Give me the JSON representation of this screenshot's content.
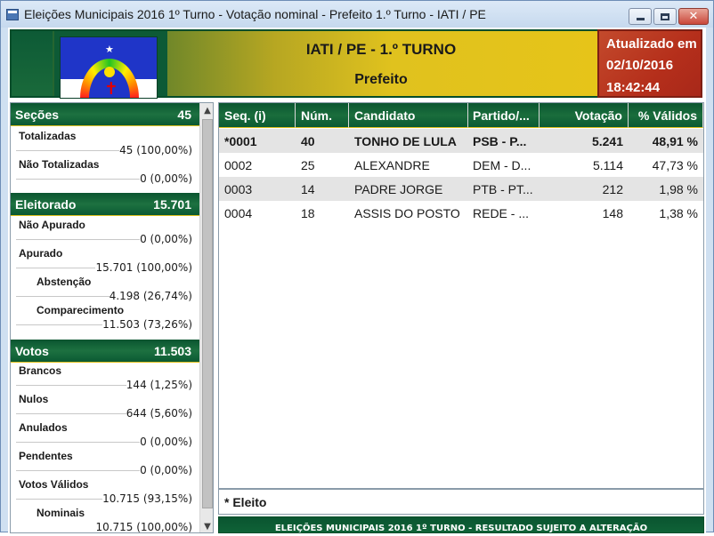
{
  "window": {
    "title": "Eleições Municipais 2016 1º Turno - Votação nominal - Prefeito 1.º Turno - IATI / PE"
  },
  "header": {
    "city_title": "IATI / PE - 1.º TURNO",
    "office_title": "Prefeito",
    "update_label": "Atualizado em",
    "update_date": "02/10/2016",
    "update_time": "18:42:44",
    "flag_icon": "pernambuco-flag"
  },
  "summary": {
    "secoes": {
      "label": "Seções",
      "value": "45",
      "items": [
        {
          "label": "Totalizadas",
          "value": "45 (100,00%)"
        },
        {
          "label": "Não Totalizadas",
          "value": "0 (0,00%)"
        }
      ]
    },
    "eleitorado": {
      "label": "Eleitorado",
      "value": "15.701",
      "items": [
        {
          "label": "Não Apurado",
          "value": "0 (0,00%)"
        },
        {
          "label": "Apurado",
          "value": "15.701 (100,00%)"
        },
        {
          "label": "Abstenção",
          "value": "4.198 (26,74%)"
        },
        {
          "label": "Comparecimento",
          "value": "11.503 (73,26%)"
        }
      ]
    },
    "votos": {
      "label": "Votos",
      "value": "11.503",
      "items": [
        {
          "label": "Brancos",
          "value": "144 (1,25%)"
        },
        {
          "label": "Nulos",
          "value": "644 (5,60%)"
        },
        {
          "label": "Anulados",
          "value": "0 (0,00%)"
        },
        {
          "label": "Pendentes",
          "value": "0 (0,00%)"
        },
        {
          "label": "Votos Válidos",
          "value": "10.715 (93,15%)"
        },
        {
          "label": "Nominais",
          "value": "10.715 (100,00%)"
        }
      ]
    }
  },
  "table": {
    "columns": [
      "Seq.  (i)",
      "Núm.",
      "Candidato",
      "Partido/...",
      "Votação",
      "% Válidos"
    ],
    "rows": [
      {
        "seq": "*0001",
        "num": "40",
        "candidato": "TONHO DE LULA",
        "partido": "PSB - P...",
        "votacao": "5.241",
        "validos": "48,91 %",
        "elected": true
      },
      {
        "seq": "0002",
        "num": "25",
        "candidato": "ALEXANDRE",
        "partido": "DEM - D...",
        "votacao": "5.114",
        "validos": "47,73 %",
        "elected": false
      },
      {
        "seq": "0003",
        "num": "14",
        "candidato": "PADRE JORGE",
        "partido": "PTB - PT...",
        "votacao": "212",
        "validos": "1,98 %",
        "elected": false
      },
      {
        "seq": "0004",
        "num": "18",
        "candidato": "ASSIS DO POSTO",
        "partido": "REDE - ...",
        "votacao": "148",
        "validos": "1,38 %",
        "elected": false
      }
    ]
  },
  "footnote": "* Eleito",
  "status_bar": "ELEIÇÕES MUNICIPAIS 2016 1º TURNO - RESULTADO SUJEITO A ALTERAÇÃO"
}
